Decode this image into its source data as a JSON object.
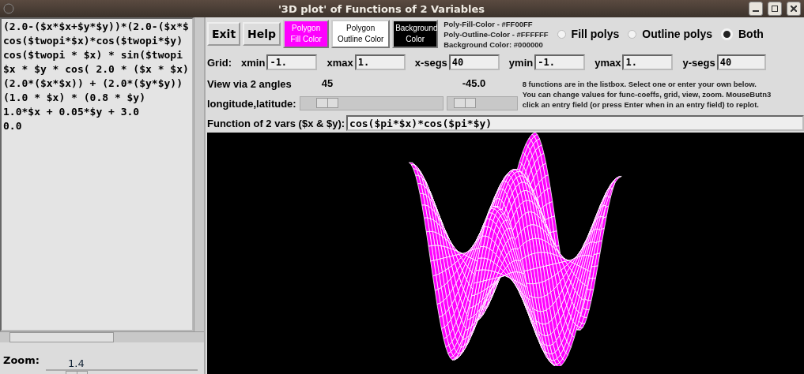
{
  "window": {
    "title": "'3D plot' of Functions of 2 Variables"
  },
  "listbox": {
    "items": [
      "(2.0-($x*$x+$y*$y))*(2.0-($x*$",
      "cos($twopi*$x)*cos($twopi*$y)",
      "cos($twopi * $x) * sin($twopi",
      "$x * $y * cos( 2.0 * ($x * $x)",
      "(2.0*($x*$x)) + (2.0*($y*$y))",
      "(1.0 * $x) * (0.8 * $y)",
      "1.0*$x + 0.05*$y + 3.0",
      "0.0"
    ]
  },
  "zoom": {
    "label": "Zoom:",
    "value": "1.4",
    "level": 0.2
  },
  "buttons": [
    "Exit",
    "Help"
  ],
  "color_buttons": [
    {
      "label": "Polygon Fill Color",
      "color": "#ff00ff"
    },
    {
      "label": "Polygon Outline Color",
      "color": "#ffffff"
    },
    {
      "label": "Background Color",
      "color": "#000000"
    }
  ],
  "color_info": [
    "Poly-Fill-Color - #FF00FF",
    "Poly-Outline-Color - #FFFFFF",
    "Background Color: #000000"
  ],
  "draw_modes": [
    {
      "label": "Fill polys",
      "selected": false
    },
    {
      "label": "Outline polys",
      "selected": false
    },
    {
      "label": "Both",
      "selected": true
    }
  ],
  "grid": {
    "label": "Grid:",
    "fields": [
      {
        "label": "xmin",
        "value": "-1."
      },
      {
        "label": "xmax",
        "value": "1."
      },
      {
        "label": "x-segs",
        "value": "40"
      },
      {
        "label": "ymin",
        "value": "-1."
      },
      {
        "label": "ymax",
        "value": "1."
      },
      {
        "label": "y-segs",
        "value": "40"
      }
    ]
  },
  "view": {
    "label_1": "View via 2 angles",
    "label_2": "longitude,latitude:",
    "angles": [
      {
        "value": "45",
        "level": 0.19
      },
      {
        "value": "-45.0",
        "level": 0.25
      }
    ]
  },
  "help_lines": [
    "8 functions are in the listbox. Select one or enter your own below.",
    "You can change values for func-coeffs, grid, view, zoom. MouseButn3",
    "click an entry field (or press Enter when in an entry field) to replot."
  ],
  "function": {
    "label": "Function of 2 vars ($x & $y):",
    "value": "cos($pi*$x)*cos($pi*$y)"
  }
}
